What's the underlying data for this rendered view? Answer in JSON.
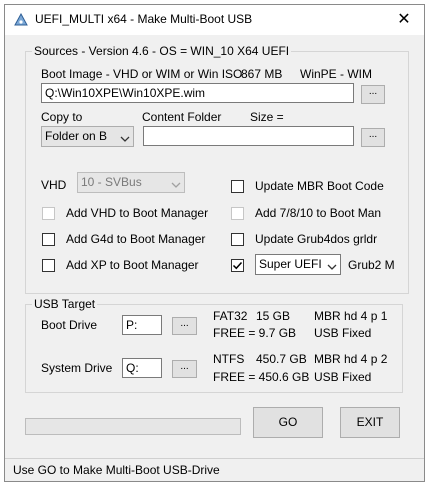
{
  "window": {
    "title": "UEFI_MULTI x64 - Make Multi-Boot USB",
    "close_glyph": "✕"
  },
  "sources": {
    "legend": "Sources  - Version 4.6  -  OS = WIN_10 X64  UEFI",
    "boot_image_label": "Boot Image - VHD or WIM or Win ISO",
    "boot_image_size": "867 MB",
    "boot_image_type": "WinPE - WIM",
    "boot_image_path": "Q:\\Win10XPE\\Win10XPE.wim",
    "browse_label": "...",
    "copy_to_label": "Copy to",
    "content_folder_label": "Content Folder",
    "size_label": "Size  =",
    "copy_to_value": "Folder on B",
    "content_folder_value": "",
    "content_browse_label": "...",
    "vhd_label": "VHD",
    "vhd_value": "10 - SVBus",
    "options_left": [
      {
        "label": "Add VHD to Boot Manager",
        "checked": false,
        "disabled": true
      },
      {
        "label": "Add G4d to Boot Manager",
        "checked": false,
        "disabled": false
      },
      {
        "label": "Add XP  to Boot Manager",
        "checked": false,
        "disabled": false
      }
    ],
    "options_right": [
      {
        "label": "Update MBR Boot Code",
        "checked": false,
        "disabled": false
      },
      {
        "label": "Add 7/8/10 to Boot Man",
        "checked": false,
        "disabled": true
      },
      {
        "label": "Update Grub4dos grldr",
        "checked": false,
        "disabled": false
      }
    ],
    "uefi_checked": true,
    "uefi_value": "Super UEFI",
    "grub_label": "Grub2 M"
  },
  "usb_target": {
    "legend": "USB Target",
    "boot_drive_label": "Boot  Drive",
    "boot_drive_value": "P:",
    "boot_browse_label": "...",
    "boot_fs": "FAT32",
    "boot_size": "15 GB",
    "boot_mbr": "MBR  hd 4  p 1",
    "boot_free": "FREE = 9.7 GB",
    "boot_usb": "USB   Fixed",
    "system_drive_label": "System Drive",
    "system_drive_value": "Q:",
    "system_browse_label": "...",
    "system_fs": "NTFS",
    "system_size": "450.7 GB",
    "system_mbr": "MBR  hd 4  p 2",
    "system_free": "FREE = 450.6 GB",
    "system_usb": "USB   Fixed"
  },
  "actions": {
    "go_label": "GO",
    "exit_label": "EXIT",
    "progress_fraction": 0
  },
  "status": {
    "text": "Use GO to Make Multi-Boot USB-Drive"
  },
  "colors": {
    "window_bg": "#f0f0f0",
    "checkmark": "#000000",
    "progress_fill": "#06b025"
  }
}
